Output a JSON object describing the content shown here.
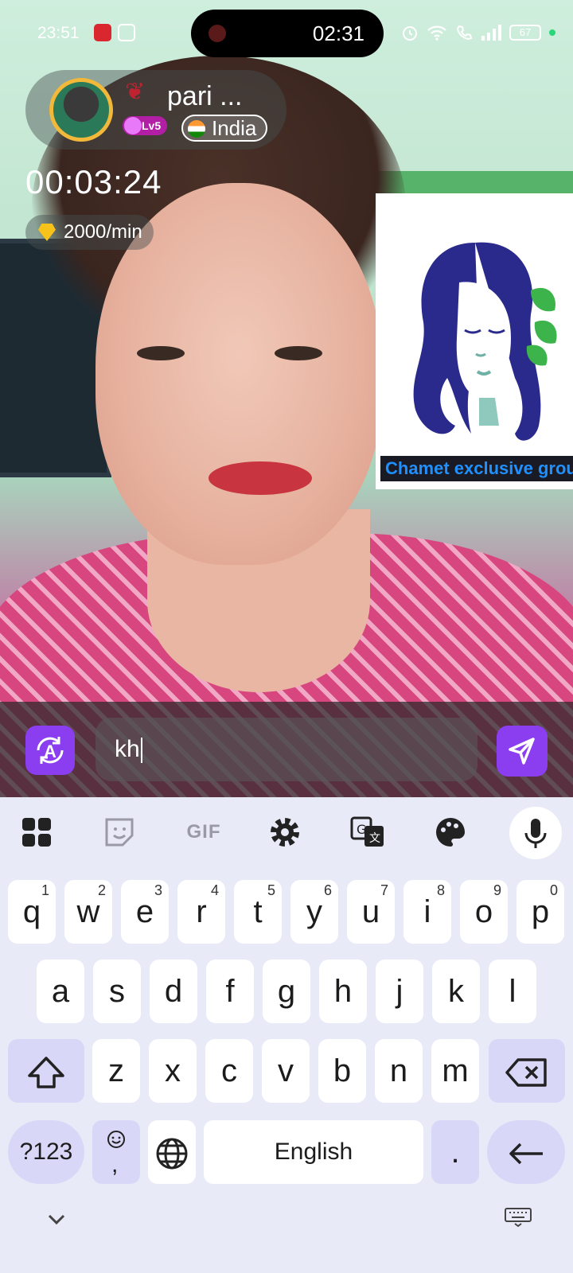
{
  "status_bar": {
    "time": "23:51",
    "recording_time": "02:31",
    "battery": "67"
  },
  "caller": {
    "name": "pari ...",
    "level": "Lv5",
    "country": "India",
    "call_duration": "00:03:24",
    "rate": "2000/min"
  },
  "preview": {
    "label": "Chamet exclusive grou"
  },
  "message": {
    "input_value": "kh",
    "translate_label": "A"
  },
  "keyboard": {
    "toolbar": {
      "gif_label": "GIF"
    },
    "row1": [
      {
        "key": "q",
        "hint": "1"
      },
      {
        "key": "w",
        "hint": "2"
      },
      {
        "key": "e",
        "hint": "3"
      },
      {
        "key": "r",
        "hint": "4"
      },
      {
        "key": "t",
        "hint": "5"
      },
      {
        "key": "y",
        "hint": "6"
      },
      {
        "key": "u",
        "hint": "7"
      },
      {
        "key": "i",
        "hint": "8"
      },
      {
        "key": "o",
        "hint": "9"
      },
      {
        "key": "p",
        "hint": "0"
      }
    ],
    "row2": [
      "a",
      "s",
      "d",
      "f",
      "g",
      "h",
      "j",
      "k",
      "l"
    ],
    "row3": [
      "z",
      "x",
      "c",
      "v",
      "b",
      "n",
      "m"
    ],
    "symbols_label": "?123",
    "comma_label": ",",
    "space_label": "English",
    "period_label": "."
  },
  "colors": {
    "accent": "#8b3df0",
    "key_function": "#d9d7f7",
    "keyboard_bg": "#e9eaf8",
    "preview_label_text": "#1e90ff"
  }
}
